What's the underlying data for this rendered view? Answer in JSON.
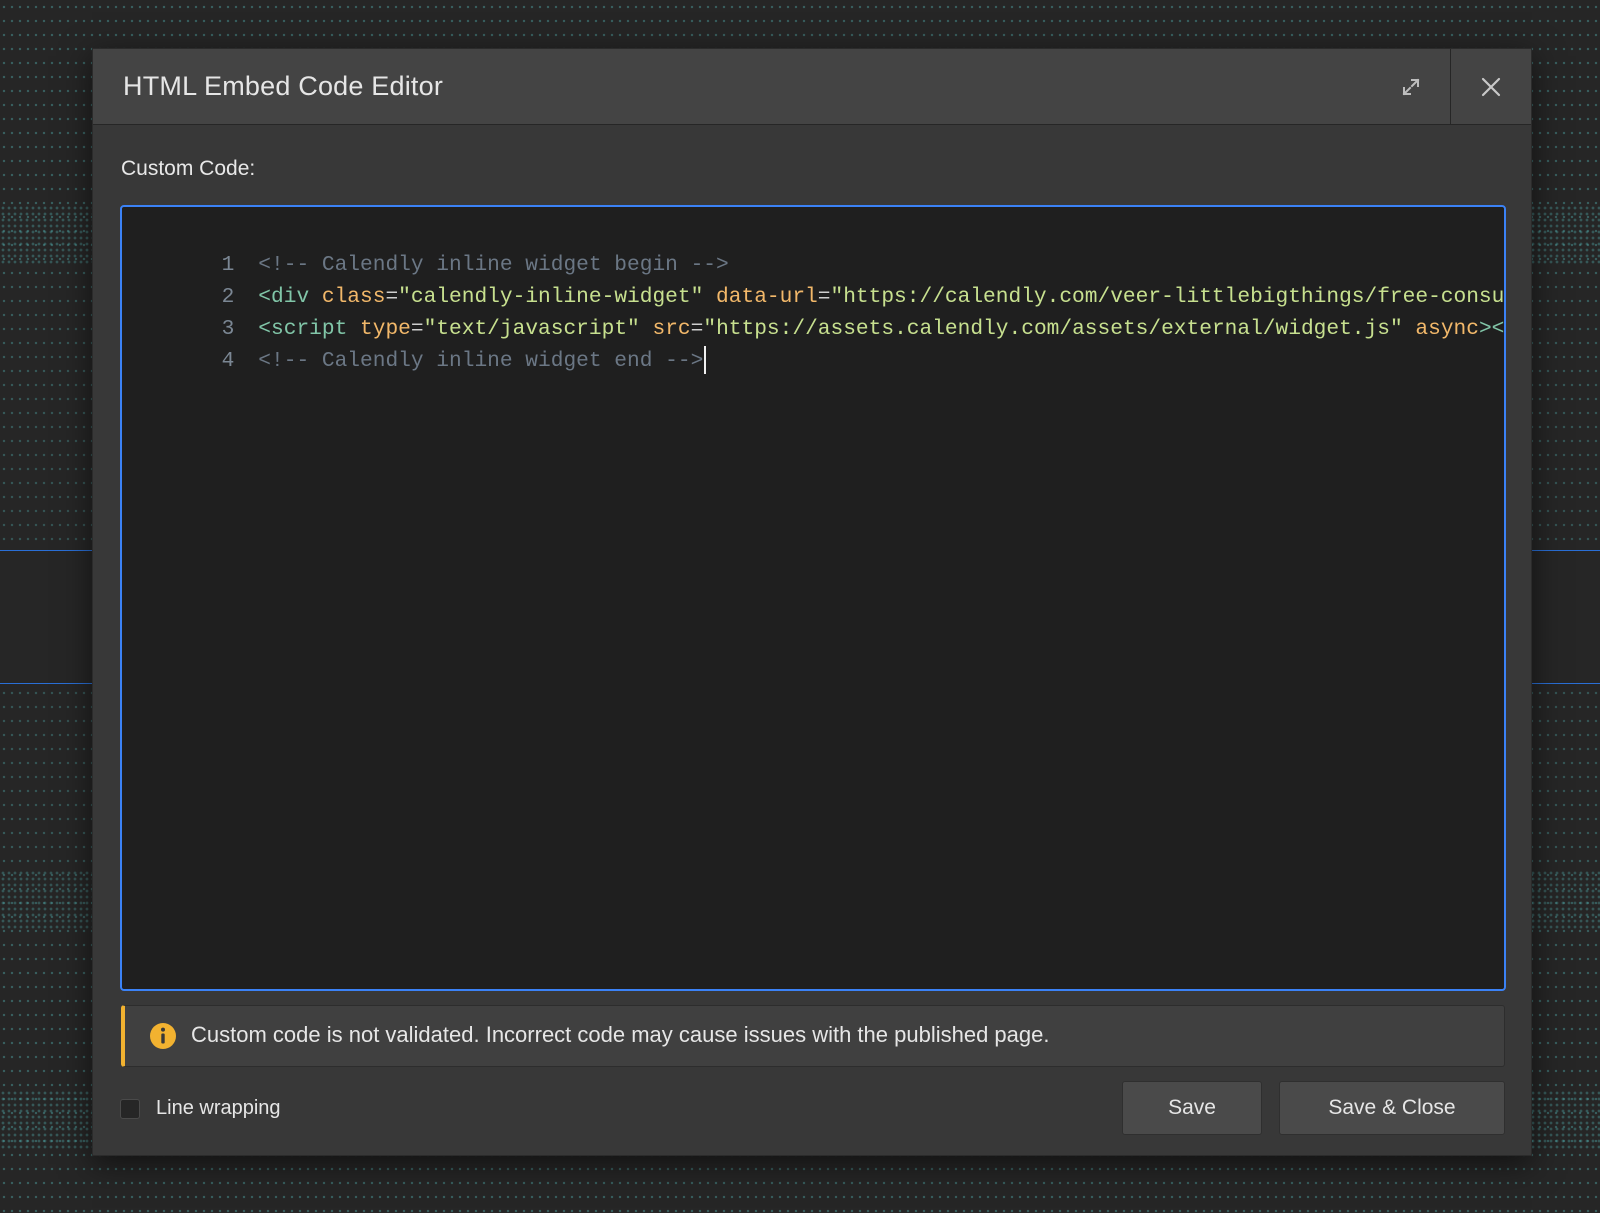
{
  "modal": {
    "title": "HTML Embed Code Editor",
    "expand_icon": "expand-icon",
    "close_icon": "close-icon"
  },
  "editor": {
    "label": "Custom Code:",
    "lines": [
      {
        "number": "1",
        "comment": "<!-- Calendly inline widget begin -->"
      },
      {
        "number": "2",
        "tag_open": "<div",
        "attr1": "class",
        "eq1": "=",
        "val1": "\"calendly-inline-widget\"",
        "attr2": "data-url",
        "eq2": "=",
        "val2": "\"https://calendly.com/veer-littlebigthings/free-consultat"
      },
      {
        "number": "3",
        "tag_open": "<script",
        "attr1": "type",
        "eq1": "=",
        "val1": "\"text/javascript\"",
        "attr2": "src",
        "eq2": "=",
        "val2": "\"https://assets.calendly.com/assets/external/widget.js\"",
        "attr3": "async",
        "tag_close": "></scr"
      },
      {
        "number": "4",
        "comment": "<!-- Calendly inline widget end -->"
      }
    ]
  },
  "warning": {
    "icon": "info-icon",
    "text": "Custom code is not validated. Incorrect code may cause issues with the published page.",
    "accent_color": "#f2b230"
  },
  "footer": {
    "line_wrapping_label": "Line wrapping",
    "line_wrapping_checked": false,
    "save_label": "Save",
    "save_close_label": "Save & Close"
  },
  "colors": {
    "editor_focus_border": "#3b82f6",
    "modal_background": "#383838",
    "editor_background": "#1f1f1f"
  }
}
